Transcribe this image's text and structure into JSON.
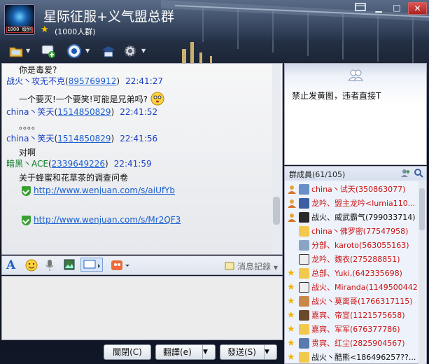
{
  "window": {
    "title": "星际征服+义气盟总群",
    "group_count": "(1000人群)",
    "logo_text": "1000 级别"
  },
  "colors": {
    "accent": "#1a40c0",
    "member_red": "#cc1111",
    "link": "#1a5fd0"
  },
  "chat": [
    {
      "type": "text",
      "text": "你是毒爱?"
    },
    {
      "type": "header",
      "sender": "战火丶攻无不克",
      "qq": "895769912",
      "time": "22:41:27",
      "color": "blue"
    },
    {
      "type": "text",
      "text": "一个要灭!一个要笑!可能是兄弟吗?"
    },
    {
      "type": "header",
      "sender": "china丶笑天",
      "qq": "1514850829",
      "time": "22:41:52",
      "color": "blue"
    },
    {
      "type": "text",
      "text": "。。。。"
    },
    {
      "type": "header",
      "sender": "china丶笑天",
      "qq": "1514850829",
      "time": "22:41:56",
      "color": "blue"
    },
    {
      "type": "text",
      "text": "对啊"
    },
    {
      "type": "header",
      "sender": "暗黑丶ACE",
      "qq": "2339649226",
      "time": "22:41:59",
      "color": "green"
    },
    {
      "type": "text",
      "text": "关于蜂蜜和花草茶的调查问卷"
    },
    {
      "type": "link",
      "url": "http://www.wenjuan.com/s/aiUfYb"
    },
    {
      "type": "link",
      "url": "http://www.wenjuan.com/s/Mr2QF3"
    }
  ],
  "input_toolbar": {
    "history_label": "消息記錄"
  },
  "buttons": {
    "close": "關閉(C)",
    "translate": "翻譯(e)",
    "send": "發送(S)"
  },
  "announcement": {
    "text": "禁止发黄图，违者直接T"
  },
  "members": {
    "title": "群成員(61/105)",
    "items": [
      {
        "name": "china丶试天(350863077)",
        "role": "admin",
        "color": "red"
      },
      {
        "name": "龙吟、盟主龙吟<lumia110...",
        "role": "admin",
        "color": "red"
      },
      {
        "name": "战火、威武霸气(799033714)",
        "role": "admin",
        "color": "black"
      },
      {
        "name": "china丶佛罗密(77547958)",
        "role": "none",
        "color": "red"
      },
      {
        "name": "分部、karoto(563055163)",
        "role": "none",
        "color": "red"
      },
      {
        "name": "龙吟、魏衣(275288851)",
        "role": "none",
        "color": "red"
      },
      {
        "name": "总部、Yuki,(642335698)",
        "role": "star",
        "color": "red"
      },
      {
        "name": "战火、Miranda(1149500442)",
        "role": "star",
        "color": "red"
      },
      {
        "name": "战火丶莫离哥(1766317115)",
        "role": "star",
        "color": "red"
      },
      {
        "name": "嘉宾、帝宣(1121575658)",
        "role": "star",
        "color": "red"
      },
      {
        "name": "嘉宾、军军(676377786)",
        "role": "star",
        "color": "red"
      },
      {
        "name": "贵宾、红尘(2825904567)",
        "role": "star",
        "color": "red"
      },
      {
        "name": "战火丶酷熊<186496257??...",
        "role": "star",
        "color": "black"
      }
    ]
  }
}
